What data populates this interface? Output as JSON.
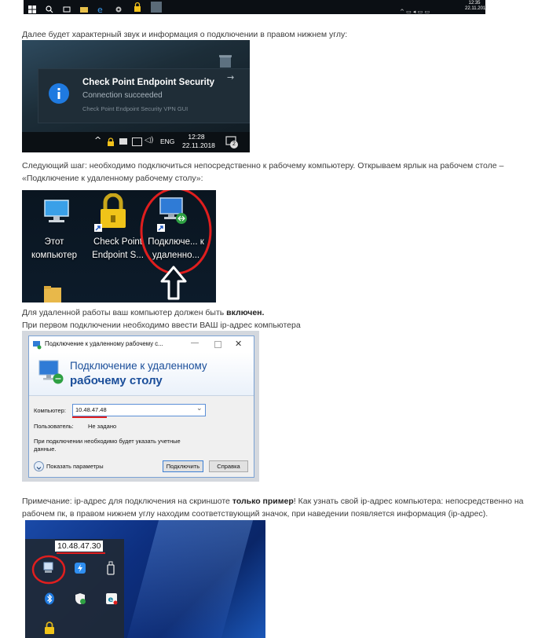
{
  "top_taskbar": {
    "time": "12:35",
    "date": "22.11.2018"
  },
  "paragraphs": {
    "p1": "Далее будет характерный звук и информация о подключении в правом нижнем углу:",
    "p2": "Следующий шаг: необходимо подключиться непосредственно к рабочему компьютеру. Открываем ярлык на рабочем столе – «Подключение к удаленному рабочему столу»:",
    "p3_text": "Для удаленной работы ваш компьютер должен быть ",
    "p3_bold": "включен.",
    "p4": "При первом подключении необходимо ввести ВАШ ip-адрес компьютера",
    "p5_a": "Примечание: ip-адрес для подключения на скриншоте ",
    "p5_bold": "только пример",
    "p5_b": "! Как узнать свой ip-адрес компьютера: непосредственно на рабочем пк, в правом нижнем углу находим соответствующий значок, при наведении появляется информация (ip-адрес)."
  },
  "toast": {
    "title": "Check Point Endpoint Security",
    "status": "Connection succeeded",
    "source": "Check Point Endpoint Security VPN GUI",
    "lang": "ENG",
    "time": "12:28",
    "date": "22.11.2018",
    "badge": "2"
  },
  "desktop_icons": {
    "computer": "Этот компьютер",
    "checkpoint": "Check Point Endpoint S...",
    "rdp": "Подключе... к удаленно..."
  },
  "rdp_dialog": {
    "window_title": "Подключение к удаленному рабочему с...",
    "heading_line1": "Подключение к удаленному",
    "heading_line2": "рабочему столу",
    "computer_label": "Компьютер:",
    "computer_value": "10.48.47.48",
    "user_label": "Пользователь:",
    "user_value": "Не задано",
    "note": "При подключении необходимо будет указать учетные данные.",
    "show_params": "Показать параметры",
    "connect": "Подключить",
    "help": "Справка"
  },
  "tray": {
    "ip": "10.48.47.30"
  },
  "colors": {
    "accent_red": "#e01e1e",
    "toast_icon_blue": "#1f7ae0",
    "tray_blue": "#1a4aa8"
  }
}
